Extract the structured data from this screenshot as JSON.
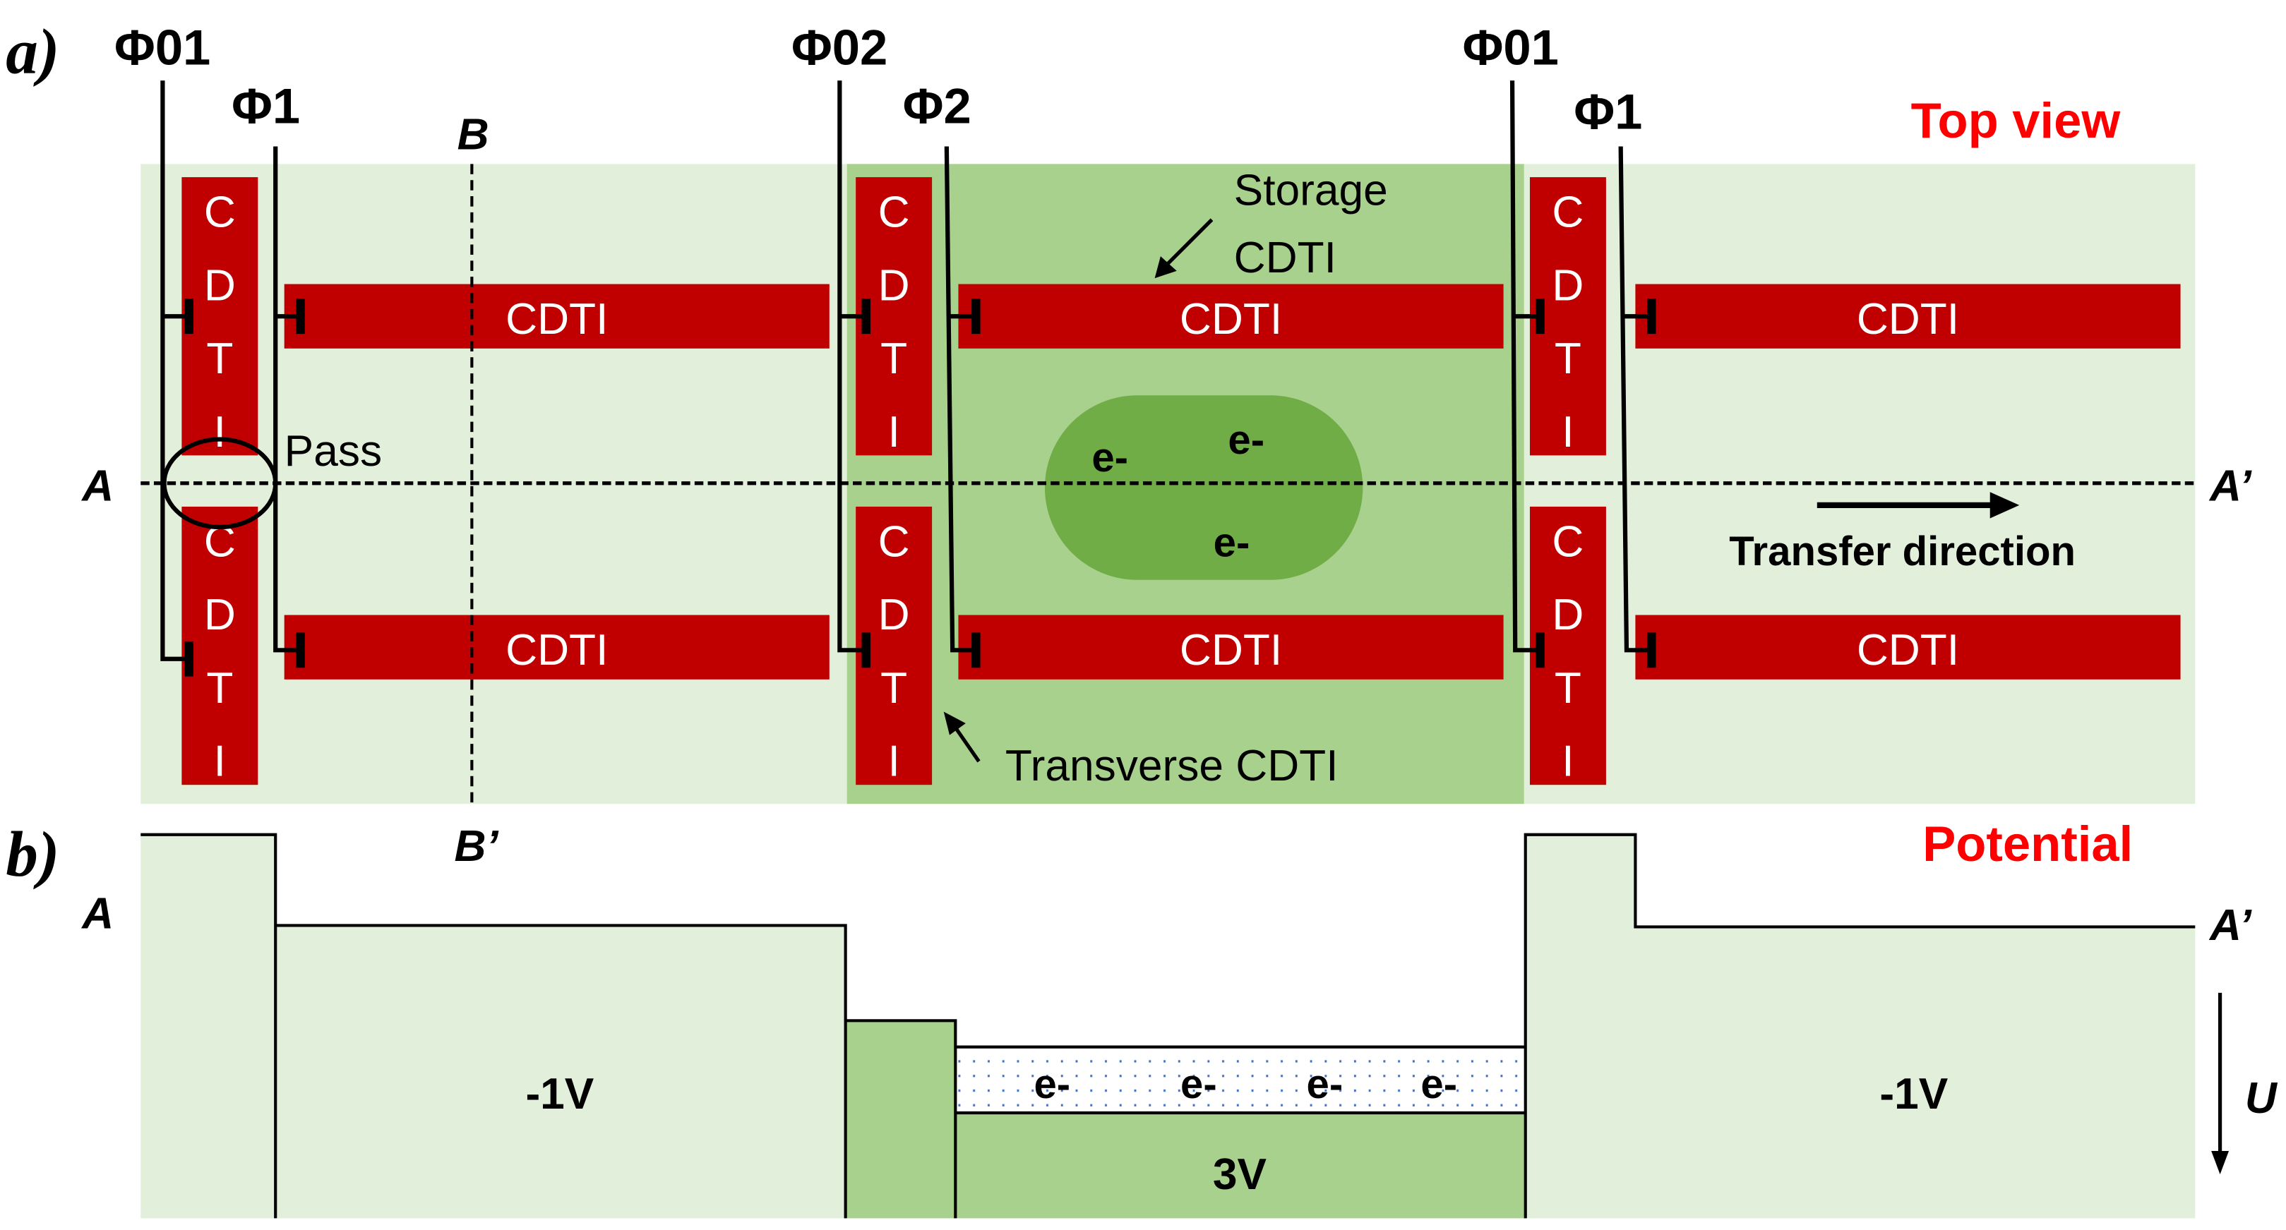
{
  "panel_a": {
    "letter": "a)",
    "title": "Top view",
    "phase_labels": [
      "Φ01",
      "Φ1",
      "Φ02",
      "Φ2",
      "Φ01",
      "Φ1"
    ],
    "section_labels": {
      "a_left": "A",
      "a_right": "A’",
      "b_top": "B",
      "b_bottom": "B’"
    },
    "cdti_vertical_letters": [
      "C",
      "D",
      "T",
      "I"
    ],
    "cdti_label": "CDTI",
    "pass_label": "Pass",
    "storage_label_line1": "Storage",
    "storage_label_line2": "CDTI",
    "transverse_label": "Transverse CDTI",
    "electron_label": "e-",
    "transfer_label": "Transfer direction"
  },
  "panel_b": {
    "letter": "b)",
    "title": "Potential",
    "left_label": "A",
    "right_label": "A’",
    "axis_label": "U",
    "left_voltage": "-1V",
    "storage_voltage": "3V",
    "right_voltage": "-1V",
    "electron_label": "e-"
  },
  "colors": {
    "light_green": "#e2efda",
    "mid_green": "#a9d18e",
    "dark_green": "#70ad47",
    "cdti_red": "#c00000",
    "title_red": "#ff0000"
  }
}
